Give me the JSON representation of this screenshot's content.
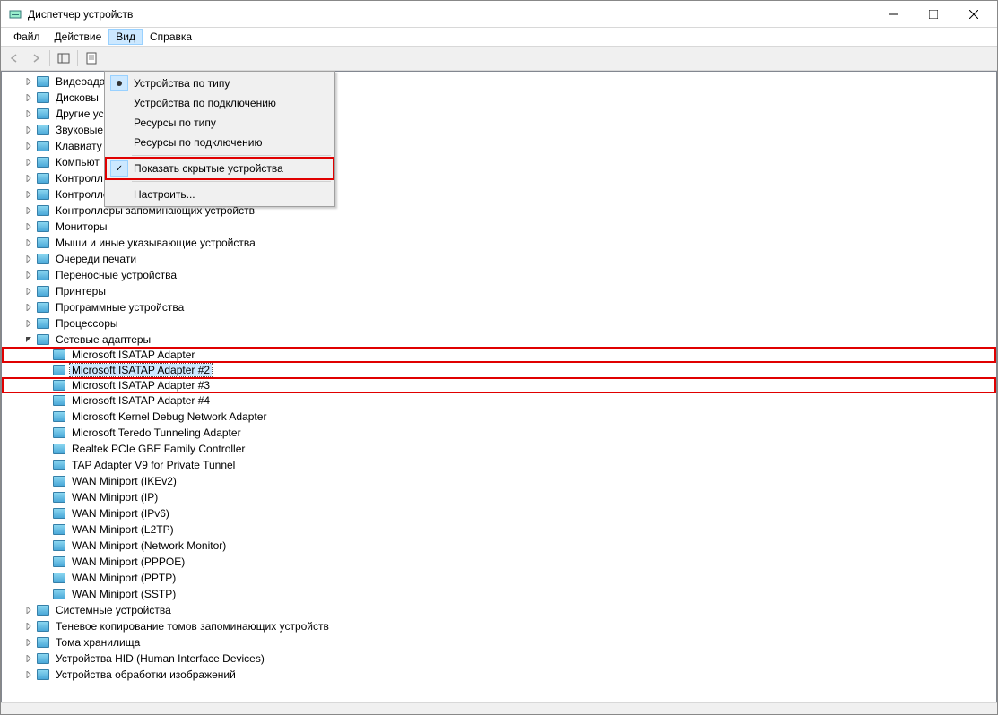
{
  "window": {
    "title": "Диспетчер устройств"
  },
  "menu": {
    "file": "Файл",
    "action": "Действие",
    "view": "Вид",
    "help": "Справка"
  },
  "dropdown": {
    "by_type": "Устройства по типу",
    "by_connection": "Устройства по подключению",
    "resources_by_type": "Ресурсы по типу",
    "resources_by_connection": "Ресурсы по подключению",
    "show_hidden": "Показать скрытые устройства",
    "customize": "Настроить..."
  },
  "tree": {
    "categories": [
      "Видеоада",
      "Дисковы",
      "Другие ус",
      "Звуковые",
      "Клавиату",
      "Компьют",
      "Контролл",
      "Контроллеры USB",
      "Контроллеры запоминающих устройств",
      "Мониторы",
      "Мыши и иные указывающие устройства",
      "Очереди печати",
      "Переносные устройства",
      "Принтеры",
      "Программные устройства",
      "Процессоры"
    ],
    "network_adapters_label": "Сетевые адаптеры",
    "network_adapters": [
      "Microsoft ISATAP Adapter",
      "Microsoft ISATAP Adapter #2",
      "Microsoft ISATAP Adapter #3",
      "Microsoft ISATAP Adapter #4",
      "Microsoft Kernel Debug Network Adapter",
      "Microsoft Teredo Tunneling Adapter",
      "Realtek PCIe GBE Family Controller",
      "TAP Adapter V9 for Private Tunnel",
      "WAN Miniport (IKEv2)",
      "WAN Miniport (IP)",
      "WAN Miniport (IPv6)",
      "WAN Miniport (L2TP)",
      "WAN Miniport (Network Monitor)",
      "WAN Miniport (PPPOE)",
      "WAN Miniport (PPTP)",
      "WAN Miniport (SSTP)"
    ],
    "categories_after": [
      "Системные устройства",
      "Теневое копирование томов запоминающих устройств",
      "Тома хранилища",
      "Устройства HID (Human Interface Devices)",
      "Устройства обработки изображений"
    ]
  }
}
